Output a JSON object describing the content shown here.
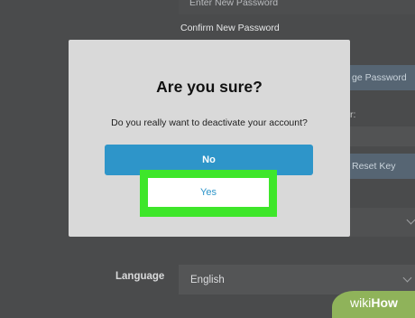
{
  "background": {
    "new_password_placeholder": "Enter New Password",
    "confirm_password_placeholder": "Confirm New Password",
    "change_password_button": "ge Password",
    "partial_label": "r:",
    "reset_key_button": "Reset Key",
    "language_label": "Language",
    "language_value": "English"
  },
  "modal": {
    "title": "Are you sure?",
    "message": "Do you really want to deactivate your account?",
    "no_label": "No",
    "yes_label": "Yes"
  },
  "watermark": {
    "brand_regular": "wiki",
    "brand_bold": "How"
  },
  "colors": {
    "overlay": "#4a4b4c",
    "modal_bg": "#d9d9d9",
    "primary_button": "#2e95c9",
    "highlight": "#3ee62a"
  }
}
